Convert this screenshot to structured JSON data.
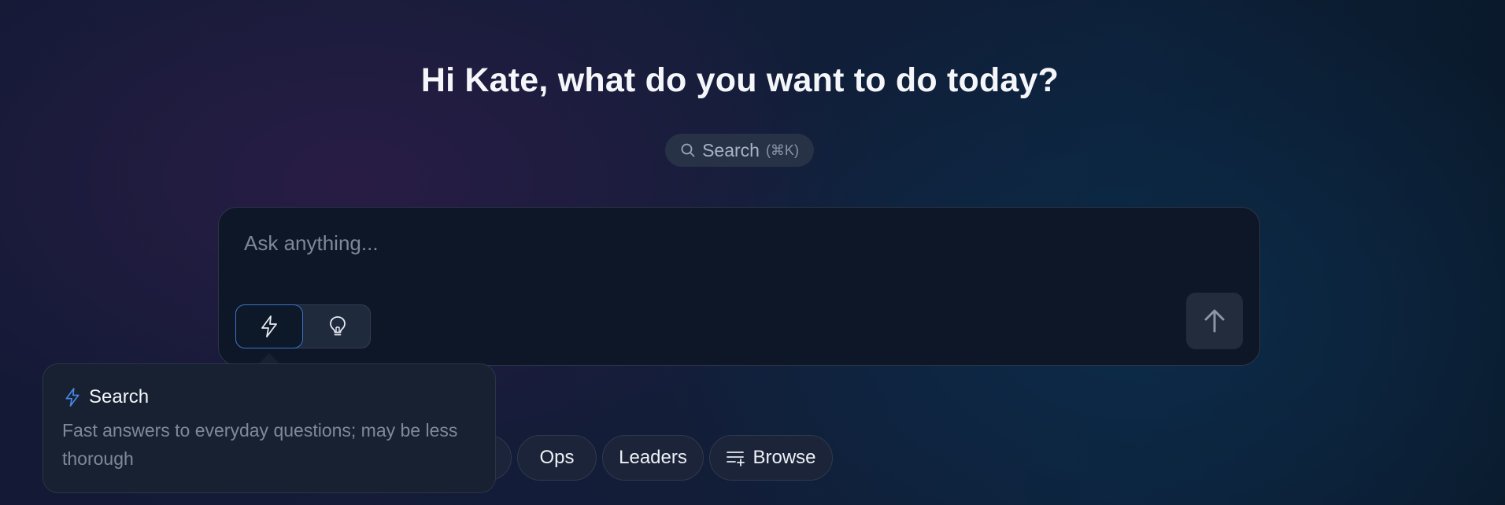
{
  "greeting": "Hi Kate, what do you want to do today?",
  "search": {
    "label": "Search",
    "shortcut": "(⌘K)",
    "icon": "search-icon"
  },
  "composer": {
    "placeholder": "Ask anything...",
    "modes": [
      {
        "name": "Search",
        "icon": "lightning-icon",
        "selected": true
      },
      {
        "name": "Think",
        "icon": "lightbulb-icon",
        "selected": false
      }
    ],
    "send_icon": "arrow-up-icon"
  },
  "tooltip": {
    "title": "Search",
    "description": "Fast answers to everyday questions; may be less thorough",
    "icon": "lightning-icon"
  },
  "chips": [
    {
      "label": "Ops"
    },
    {
      "label": "Leaders"
    },
    {
      "label": "Browse",
      "icon": "list-add-icon"
    }
  ],
  "colors": {
    "accent": "#3e72c4",
    "lightning_icon": "#4a86e8"
  }
}
